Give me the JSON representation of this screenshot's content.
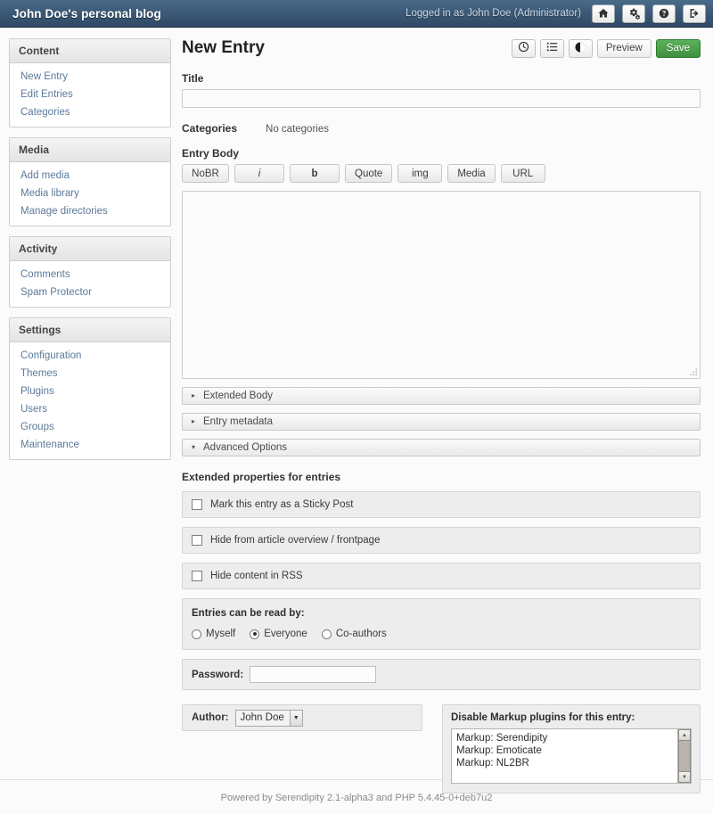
{
  "topbar": {
    "title": "John Doe's personal blog",
    "user_status": "Logged in as John Doe (Administrator)",
    "buttons": [
      {
        "name": "home-icon",
        "label": "Home"
      },
      {
        "name": "gears-icon",
        "label": "Configuration"
      },
      {
        "name": "help-icon",
        "label": "Help"
      },
      {
        "name": "logout-icon",
        "label": "Logout"
      }
    ]
  },
  "sidebar": {
    "groups": [
      {
        "title": "Content",
        "items": [
          {
            "label": "New Entry"
          },
          {
            "label": "Edit Entries"
          },
          {
            "label": "Categories"
          }
        ]
      },
      {
        "title": "Media",
        "items": [
          {
            "label": "Add media"
          },
          {
            "label": "Media library"
          },
          {
            "label": "Manage directories"
          }
        ]
      },
      {
        "title": "Activity",
        "items": [
          {
            "label": "Comments"
          },
          {
            "label": "Spam Protector"
          }
        ]
      },
      {
        "title": "Settings",
        "items": [
          {
            "label": "Configuration"
          },
          {
            "label": "Themes"
          },
          {
            "label": "Plugins"
          },
          {
            "label": "Users"
          },
          {
            "label": "Groups"
          },
          {
            "label": "Maintenance"
          }
        ]
      }
    ]
  },
  "main": {
    "page_title": "New Entry",
    "actions": {
      "clock_icon": "clock-icon",
      "list_icon": "list-icon",
      "contrast_icon": "contrast-icon",
      "preview_label": "Preview",
      "save_label": "Save"
    },
    "title_field": {
      "label": "Title",
      "value": "",
      "placeholder": ""
    },
    "categories": {
      "label": "Categories",
      "value": "No categories"
    },
    "entry_body": {
      "label": "Entry Body",
      "value": "",
      "markup_buttons": [
        {
          "label": "NoBR",
          "style": "plain"
        },
        {
          "label": "i",
          "style": "italic"
        },
        {
          "label": "b",
          "style": "bold"
        },
        {
          "label": "Quote",
          "style": "plain"
        },
        {
          "label": "img",
          "style": "plain"
        },
        {
          "label": "Media",
          "style": "plain"
        },
        {
          "label": "URL",
          "style": "plain"
        }
      ]
    },
    "accordions": [
      {
        "label": "Extended Body",
        "expanded": false,
        "marker": "▸"
      },
      {
        "label": "Entry metadata",
        "expanded": false,
        "marker": "▸"
      },
      {
        "label": "Advanced Options",
        "expanded": true,
        "marker": "▾"
      }
    ],
    "extended_properties": {
      "heading": "Extended properties for entries",
      "checkboxes": [
        {
          "label": "Mark this entry as a Sticky Post",
          "checked": false
        },
        {
          "label": "Hide from article overview / frontpage",
          "checked": false
        },
        {
          "label": "Hide content in RSS",
          "checked": false
        }
      ]
    },
    "read_by": {
      "title": "Entries can be read by:",
      "options": [
        {
          "label": "Myself",
          "selected": false
        },
        {
          "label": "Everyone",
          "selected": true
        },
        {
          "label": "Co-authors",
          "selected": false
        }
      ]
    },
    "password": {
      "label": "Password:",
      "value": "",
      "placeholder": ""
    },
    "author": {
      "label": "Author:",
      "selected": "John Doe",
      "options": [
        "John Doe"
      ]
    },
    "markup_plugins": {
      "title": "Disable Markup plugins for this entry:",
      "items": [
        "Markup: Serendipity",
        "Markup: Emoticate",
        "Markup: NL2BR"
      ]
    }
  },
  "footer": {
    "text": "Powered by Serendipity 2.1-alpha3 and PHP 5.4.45-0+deb7u2"
  },
  "colors": {
    "header_bg": "#3c5a78",
    "save_green": "#3f8f3f",
    "link_blue": "#5b7a9a",
    "page_bg": "#fbfbfb"
  }
}
